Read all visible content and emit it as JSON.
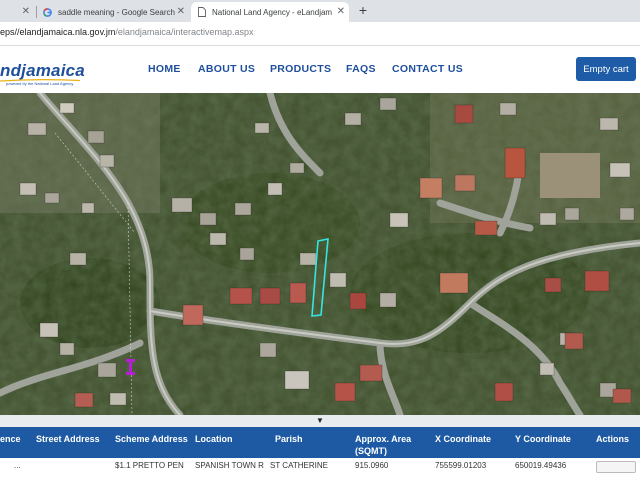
{
  "browser": {
    "tabs": [
      {
        "label": "",
        "close": "✕",
        "active": false
      },
      {
        "label": "saddle meaning - Google Search",
        "close": "✕",
        "active": false
      },
      {
        "label": "National Land Agency - eLandjam",
        "close": "✕",
        "active": true
      }
    ],
    "new_tab": "+",
    "url_host": "eps//elandjamaica.nla.gov.jm",
    "url_path": "/elandjamaica/interactivemap.aspx"
  },
  "site": {
    "logo": "ndjamaica",
    "logo_tagline": "powered by the National Land Agency",
    "nav": [
      "HOME",
      "ABOUT US",
      "PRODUCTS",
      "FAQS",
      "CONTACT US"
    ],
    "cart_button": "Empty cart"
  },
  "map": {
    "marker_label": "i",
    "collapse_icon": "▼"
  },
  "table": {
    "columns": [
      "ence",
      "Street Address",
      "Scheme Address",
      "Location",
      "Parish",
      "Approx. Area",
      "(SQMT)",
      "X Coordinate",
      "Y Coordinate",
      "Actions"
    ],
    "row": [
      "...",
      "$1.1 PRETTO PEN",
      "SPANISH TOWN R",
      "ST CATHERINE",
      "915.0960",
      "755599.01203",
      "650019.49436"
    ]
  },
  "colors": {
    "brand_blue": "#1e4f9c",
    "table_header": "#1d5aa3",
    "parcel_outline": "#33e6e0",
    "marker": "#b51fd6"
  }
}
